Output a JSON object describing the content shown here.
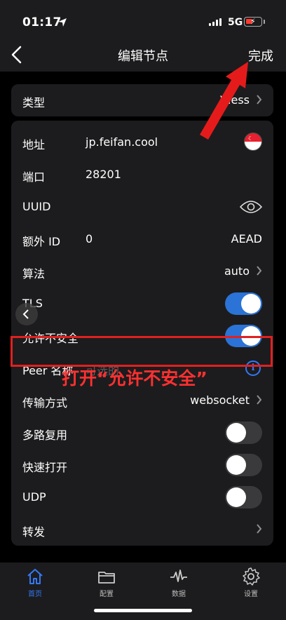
{
  "status_bar": {
    "time": "01:17",
    "network": "5G"
  },
  "nav": {
    "title": "编辑节点",
    "done": "完成"
  },
  "type_row": {
    "label": "类型",
    "value": "Vless"
  },
  "rows": {
    "address": {
      "label": "地址",
      "value": "jp.feifan.cool"
    },
    "port": {
      "label": "端口",
      "value": "28201"
    },
    "uuid": {
      "label": "UUID"
    },
    "extra_id": {
      "label": "额外 ID",
      "value": "0",
      "right": "AEAD"
    },
    "algorithm": {
      "label": "算法",
      "value": "auto"
    },
    "tls": {
      "label": "TLS",
      "on": true
    },
    "allow_insecure": {
      "label": "允许不安全",
      "on": true
    },
    "peer_name": {
      "label": "Peer 名称",
      "placeholder": "可选的"
    },
    "transport": {
      "label": "传输方式",
      "value": "websocket"
    },
    "multiplex": {
      "label": "多路复用",
      "on": false
    },
    "fast_open": {
      "label": "快速打开",
      "on": false
    },
    "udp": {
      "label": "UDP",
      "on": false
    },
    "forward": {
      "label": "转发"
    }
  },
  "annotation": "打开“允许不安全”",
  "tabs": [
    {
      "label": "首页",
      "icon": "home-icon",
      "active": true
    },
    {
      "label": "配置",
      "icon": "folder-icon",
      "active": false
    },
    {
      "label": "数据",
      "icon": "waveform-icon",
      "active": false
    },
    {
      "label": "设置",
      "icon": "gear-icon",
      "active": false
    }
  ],
  "colors": {
    "accent": "#2b73d6",
    "annotation": "#e02020",
    "background": "#000000",
    "card": "#1c1c1e"
  }
}
